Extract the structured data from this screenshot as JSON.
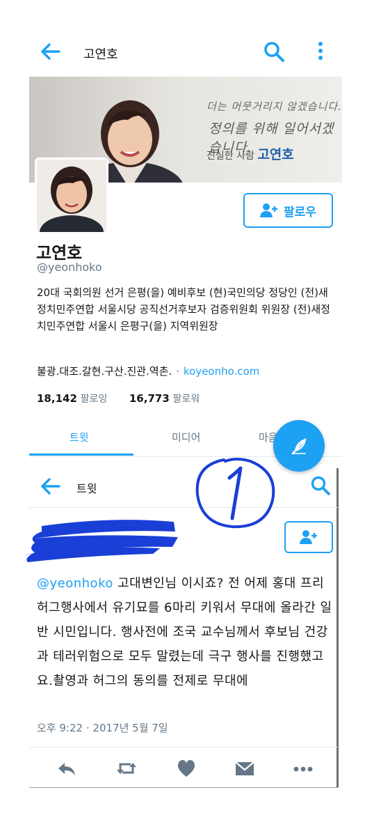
{
  "profile_screen": {
    "header_title": "고연호",
    "banner": {
      "line1": "더는 머뭇거리지 않겠습니다.",
      "line2": "정의를 위해 일어서겠습니다.",
      "sign_prefix": "진실한 사람",
      "sign_name": "고연호"
    },
    "follow_label": "팔로우",
    "name": "고연호",
    "handle": "@yeonhoko",
    "bio": "20대 국회의원 선거 은평(을) 예비후보 (현)국민의당 정당인 (전)새정치민주연합 서울시당 공직선거후보자 검증위원회 위원장 (전)새정치민주연합 서울시 은평구(을) 지역위원장",
    "location": "불광.대조.갈현.구산.진관.역촌.",
    "separator": "·",
    "website": "koyeonho.com",
    "following_count": "18,142",
    "following_label": "팔로잉",
    "followers_count": "16,773",
    "followers_label": "팔로워",
    "tabs": [
      {
        "label": "트윗",
        "active": true
      },
      {
        "label": "미디어",
        "active": false
      },
      {
        "label": "마음",
        "active": false
      }
    ]
  },
  "tweet_screen": {
    "header_title": "트윗",
    "handwritten_mark": "1",
    "tweet": {
      "mention": "@yeonhoko",
      "body": " 고대변인님 이시죠? 전 어제 홍대 프리허그행사에서 유기묘를 6마리 키워서 무대에 올라간 일반 시민입니다.  행사전에 조국 교수님께서 후보님 건강과 테러위험으로 모두 말렸는데 극구 행사를 진행했고요.촬영과 허그의 동의를 전제로 무대에",
      "time": "오후 9:22",
      "separator": "·",
      "date": "2017년 5월 7일"
    },
    "actions": [
      "reply-icon",
      "retweet-icon",
      "heart-icon",
      "dm-icon",
      "more-icon"
    ]
  },
  "colors": {
    "accent": "#1da1f2",
    "text": "#14171a",
    "muted": "#657786",
    "pen": "#1a3fd6"
  }
}
